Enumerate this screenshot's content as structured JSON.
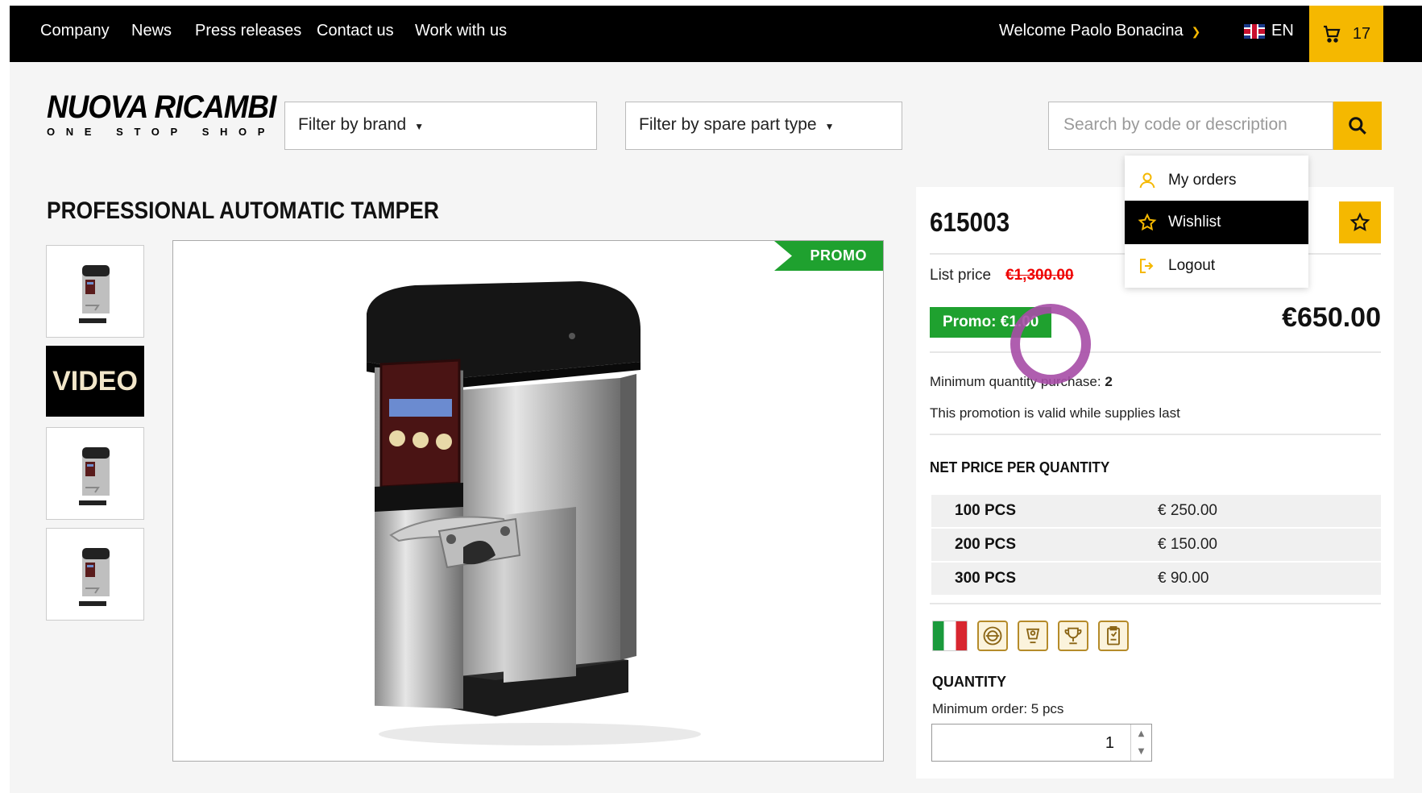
{
  "topnav": {
    "links": [
      "Company",
      "News",
      "Press releases",
      "Contact us",
      "Work with us"
    ],
    "welcome": "Welcome Paolo Bonacina",
    "language": "EN",
    "cart_count": "17"
  },
  "header": {
    "logo_line1": "NUOVA RICAMBI",
    "logo_line2": "ONE STOP SHOP",
    "filter_brand": "Filter by brand",
    "filter_type": "Filter by spare part type",
    "search_placeholder": "Search by code or description"
  },
  "product": {
    "title": "PROFESSIONAL AUTOMATIC TAMPER",
    "video_label": "VIDEO",
    "promo_tag": "PROMO",
    "code": "615003",
    "list_price_label": "List price",
    "list_price": "€1,300.00",
    "promo_badge": "Promo: €1.00",
    "price": "€650.00",
    "min_purchase_label": "Minimum quantity purchase:",
    "min_purchase_value": "2",
    "validity_note": "This promotion is valid while supplies last",
    "net_price_heading": "NET PRICE PER QUANTITY",
    "quantity_prices": [
      {
        "qty": "100 PCS",
        "price": "€ 250.00"
      },
      {
        "qty": "200 PCS",
        "price": "€ 150.00"
      },
      {
        "qty": "300 PCS",
        "price": "€ 90.00"
      }
    ],
    "quantity_heading": "QUANTITY",
    "min_order": "Minimum order: 5 pcs",
    "quantity_value": "1"
  },
  "user_menu": {
    "items": [
      {
        "label": "My orders",
        "icon": "user-icon"
      },
      {
        "label": "Wishlist",
        "icon": "star-icon",
        "active": true
      },
      {
        "label": "Logout",
        "icon": "logout-icon"
      }
    ]
  },
  "colors": {
    "accent": "#f5b800",
    "promo_green": "#1fa12f",
    "strike_red": "#e00000",
    "topbar": "#000000"
  }
}
